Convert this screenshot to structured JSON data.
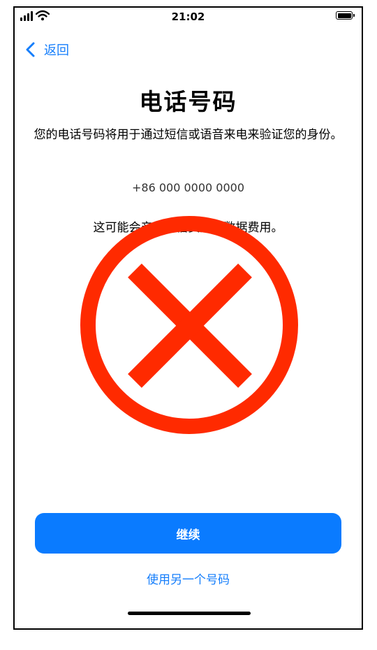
{
  "status_bar": {
    "time": "21:02",
    "icons": [
      "signal-icon",
      "wifi-icon",
      "battery-icon"
    ]
  },
  "nav": {
    "back_label": "返回",
    "back_icon": "chevron-left-icon"
  },
  "page": {
    "title": "电话号码",
    "description": "您的电话号码将用于通过短信或语音来电来验证您的身份。",
    "phone_number": "+86 000 0000 0000",
    "fee_note": "这可能会产生短信费用或数据费用。"
  },
  "actions": {
    "continue_label": "继续",
    "alt_number_label": "使用另一个号码"
  },
  "overlay": {
    "icon": "red-x-circle-icon",
    "color": "#ff2a00"
  },
  "colors": {
    "accent": "#157efb",
    "button": "#0a7bff"
  }
}
